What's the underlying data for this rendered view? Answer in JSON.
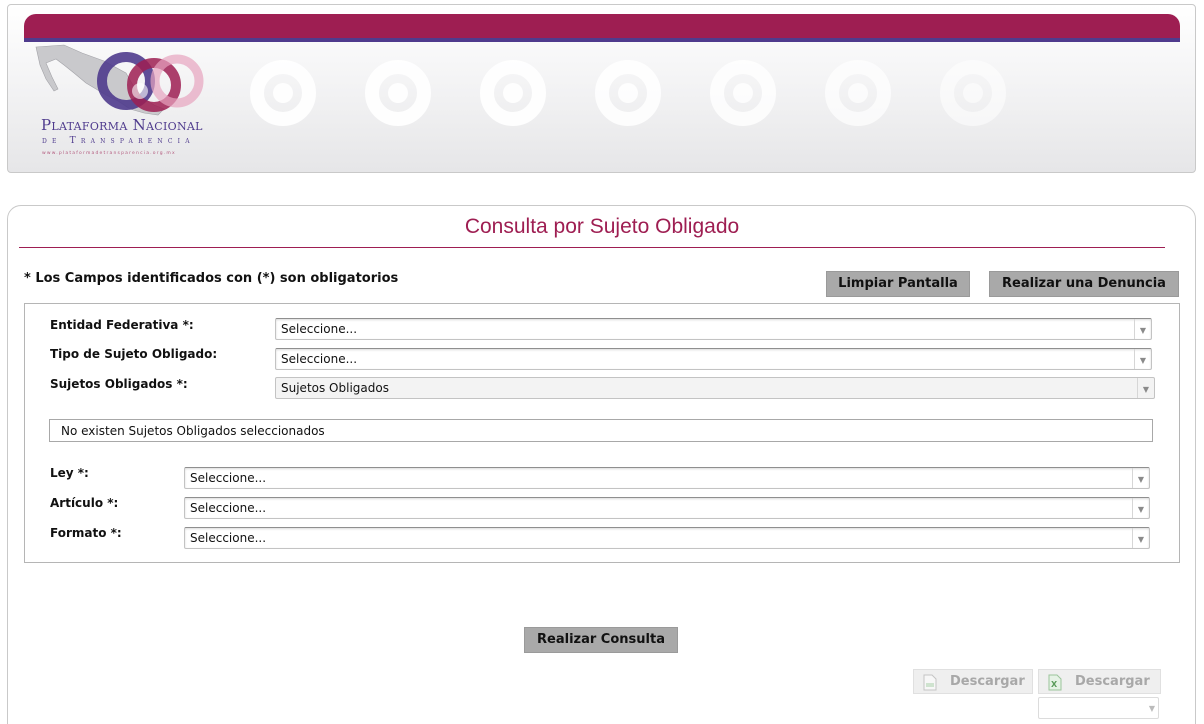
{
  "header": {
    "logo_line1": "Plataforma Nacional",
    "logo_line2": "de Transparencia",
    "logo_url": "www.plataformadetransparencia.org.mx",
    "colors": {
      "brand": "#9e1e52",
      "accent": "#4f3b8d"
    }
  },
  "page": {
    "title": "Consulta por Sujeto Obligado",
    "required_note": "* Los Campos identificados con (*) son obligatorios"
  },
  "actions": {
    "clear_label": "Limpiar Pantalla",
    "denuncia_label": "Realizar una Denuncia",
    "consulta_label": "Realizar Consulta"
  },
  "form": {
    "entidad": {
      "label": "Entidad Federativa *:",
      "value": "Seleccione..."
    },
    "tipo": {
      "label": "Tipo de Sujeto Obligado:",
      "value": "Seleccione..."
    },
    "sujetos": {
      "label": "Sujetos Obligados *:",
      "value": "Sujetos Obligados"
    },
    "empty_message": "No existen Sujetos Obligados seleccionados",
    "ley": {
      "label": "Ley *:",
      "value": "Seleccione..."
    },
    "articulo": {
      "label": "Artículo *:",
      "value": "Seleccione..."
    },
    "formato": {
      "label": "Formato *:",
      "value": "Seleccione..."
    }
  },
  "downloads": {
    "pdf_label": "Descargar",
    "excel_label": "Descargar",
    "format_value": ""
  },
  "icons": {
    "dropdown": "chevron-down-icon",
    "pdf": "document-icon",
    "excel": "excel-icon"
  }
}
